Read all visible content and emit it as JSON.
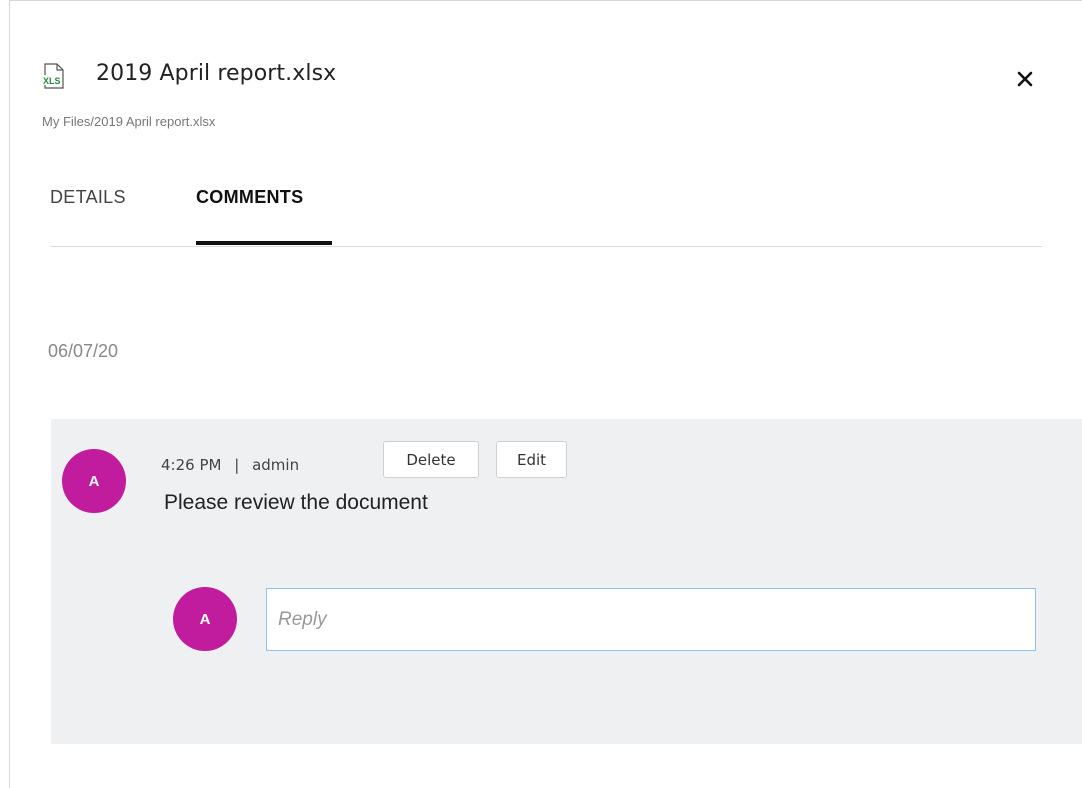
{
  "file": {
    "icon": "xls-file-icon",
    "icon_text": "XLS",
    "title": "2019 April report.xlsx",
    "breadcrumb": "My Files/2019 April report.xlsx",
    "icon_color": "#1f8a3c"
  },
  "close_icon": "close-icon",
  "tabs": [
    {
      "label": "DETAILS",
      "active": false
    },
    {
      "label": "COMMENTS",
      "active": true
    }
  ],
  "comments": {
    "date": "06/07/20",
    "items": [
      {
        "avatar_initial": "A",
        "time": "4:26 PM",
        "separator": "|",
        "author": "admin",
        "delete_label": "Delete",
        "edit_label": "Edit",
        "text": "Please review the document"
      }
    ],
    "reply": {
      "avatar_initial": "A",
      "placeholder": "Reply",
      "value": ""
    }
  },
  "colors": {
    "avatar": "#c11c9e",
    "comment_bg": "#eff0f2",
    "input_border": "#8fc2ee"
  }
}
